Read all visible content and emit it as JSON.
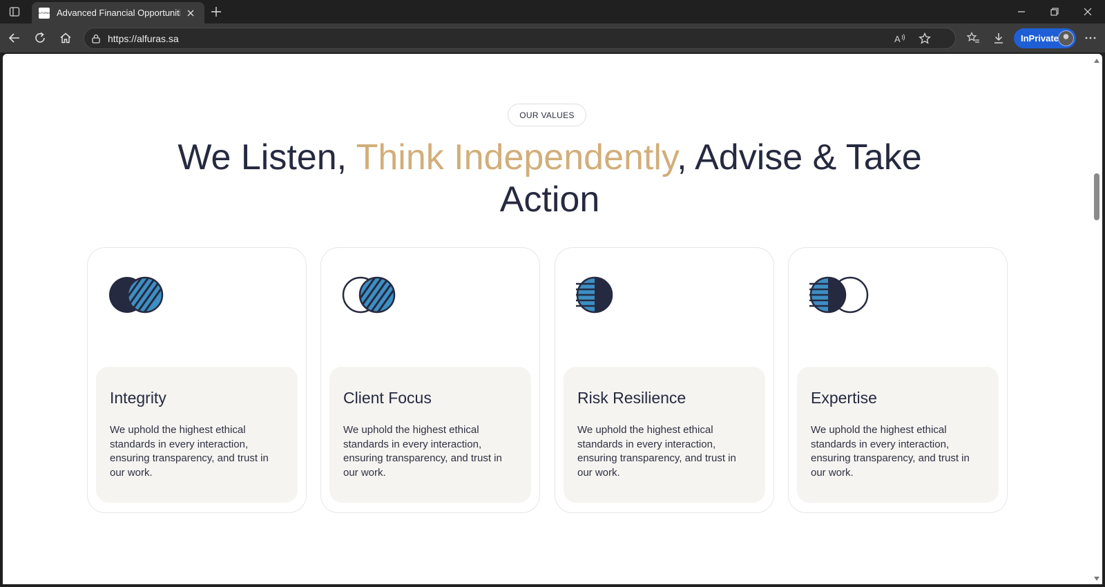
{
  "browser": {
    "tab_title": "Advanced Financial Opportunities",
    "favicon_text": "ALFURAS",
    "url": "https://alfuras.sa",
    "inprivate_label": "InPrivate"
  },
  "section": {
    "badge": "OUR VALUES",
    "heading_part1": "We Listen, ",
    "heading_accent": "Think Independently",
    "heading_part2": ", Advise & Take Action",
    "accent_color": "#d2ae7a",
    "heading_color": "#262a40",
    "icon_blue": "#3d8fc4",
    "icon_navy": "#262a40"
  },
  "cards": [
    {
      "title": "Integrity",
      "description": "We uphold the highest ethical standards in every interaction, ensuring transparency, and trust in our work.",
      "icon": "overlapping-circles-diagonal-stripes-icon"
    },
    {
      "title": "Client Focus",
      "description": "We uphold the highest ethical standards in every interaction, ensuring transparency, and trust in our work.",
      "icon": "outline-circle-with-striped-circle-icon"
    },
    {
      "title": "Risk Resilience",
      "description": "We uphold the highest ethical standards in every interaction, ensuring transparency, and trust in our work.",
      "icon": "half-striped-circle-icon"
    },
    {
      "title": "Expertise",
      "description": "We uphold the highest ethical standards in every interaction, ensuring transparency, and trust in our work.",
      "icon": "half-striped-circle-with-outline-circle-icon"
    }
  ]
}
